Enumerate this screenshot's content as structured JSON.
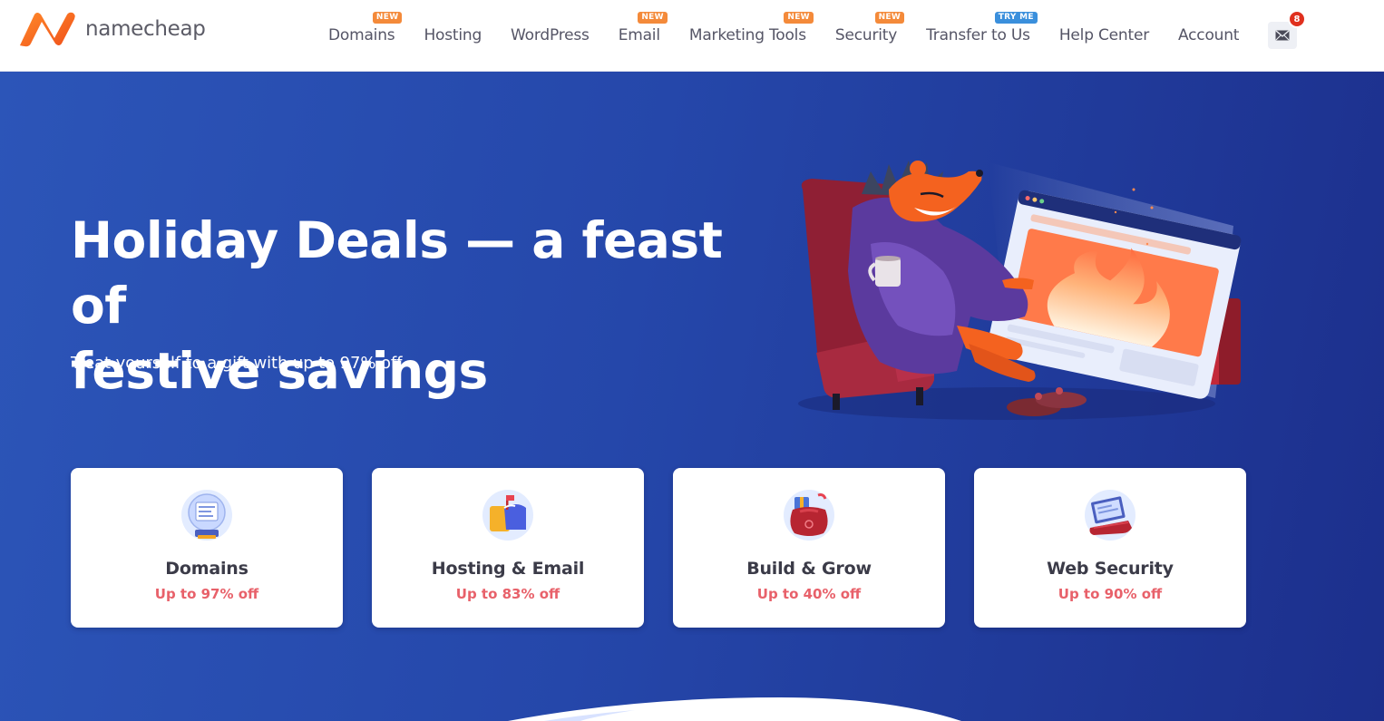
{
  "brand": {
    "name": "namecheap",
    "colors": {
      "orange": "#f4621f",
      "hero_blue": "#2547aa",
      "discount_red": "#e8616a",
      "badge_new": "#f48a3a",
      "badge_try": "#3a8fdc"
    }
  },
  "nav": {
    "items": [
      {
        "label": "Domains",
        "badge": "NEW"
      },
      {
        "label": "Hosting",
        "badge": ""
      },
      {
        "label": "WordPress",
        "badge": ""
      },
      {
        "label": "Email",
        "badge": "NEW"
      },
      {
        "label": "Marketing Tools",
        "badge": "NEW"
      },
      {
        "label": "Security",
        "badge": "NEW"
      },
      {
        "label": "Transfer to Us",
        "badge": "TRY ME"
      },
      {
        "label": "Help Center",
        "badge": ""
      },
      {
        "label": "Account",
        "badge": ""
      }
    ],
    "mail": {
      "icon": "envelope-icon",
      "count": "8"
    }
  },
  "hero": {
    "title_line1": "Holiday Deals — a feast of",
    "title_line2": "festive savings",
    "subtitle": "Treat yourself to a gift with up to 97% off",
    "illustration": "hedgehog-by-fireplace-illustration"
  },
  "cards": [
    {
      "title": "Domains",
      "discount": "Up to 97% off",
      "icon": "snow-globe-domain-icon"
    },
    {
      "title": "Hosting & Email",
      "discount": "Up to 83% off",
      "icon": "mailbox-icon"
    },
    {
      "title": "Build & Grow",
      "discount": "Up to 40% off",
      "icon": "gift-sack-icon"
    },
    {
      "title": "Web Security",
      "discount": "Up to 90% off",
      "icon": "laptop-shield-icon"
    }
  ]
}
